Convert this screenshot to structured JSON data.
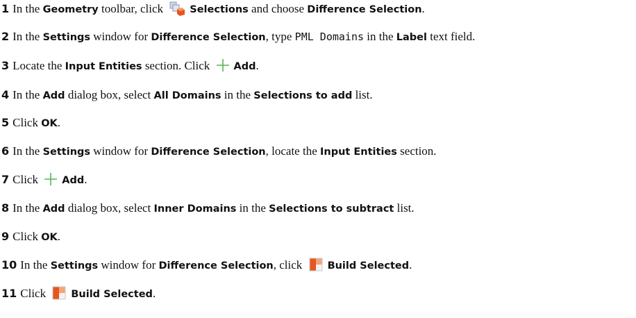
{
  "steps": [
    {
      "number": "1",
      "parts": [
        {
          "t": "t",
          "v": "In the "
        },
        {
          "t": "b",
          "v": "Geometry"
        },
        {
          "t": "t",
          "v": " toolbar, click "
        },
        {
          "t": "icon",
          "icon": "selections-icon"
        },
        {
          "t": "b",
          "v": "Selections"
        },
        {
          "t": "t",
          "v": " and choose "
        },
        {
          "t": "b",
          "v": "Difference Selection"
        },
        {
          "t": "t",
          "v": "."
        }
      ]
    },
    {
      "number": "2",
      "parts": [
        {
          "t": "t",
          "v": "In the "
        },
        {
          "t": "b",
          "v": "Settings"
        },
        {
          "t": "t",
          "v": " window for "
        },
        {
          "t": "b",
          "v": "Difference Selection"
        },
        {
          "t": "t",
          "v": ", type "
        },
        {
          "t": "m",
          "v": "PML Domains"
        },
        {
          "t": "t",
          "v": " in the "
        },
        {
          "t": "b",
          "v": "Label"
        },
        {
          "t": "t",
          "v": " text field."
        }
      ]
    },
    {
      "number": "3",
      "parts": [
        {
          "t": "t",
          "v": "Locate the "
        },
        {
          "t": "b",
          "v": "Input Entities"
        },
        {
          "t": "t",
          "v": " section. Click "
        },
        {
          "t": "icon",
          "icon": "add-plus-icon"
        },
        {
          "t": "b",
          "v": "Add"
        },
        {
          "t": "t",
          "v": "."
        }
      ]
    },
    {
      "number": "4",
      "parts": [
        {
          "t": "t",
          "v": "In the "
        },
        {
          "t": "b",
          "v": "Add"
        },
        {
          "t": "t",
          "v": " dialog box, select "
        },
        {
          "t": "b",
          "v": "All Domains"
        },
        {
          "t": "t",
          "v": " in the "
        },
        {
          "t": "b",
          "v": "Selections to add"
        },
        {
          "t": "t",
          "v": " list."
        }
      ]
    },
    {
      "number": "5",
      "parts": [
        {
          "t": "t",
          "v": "Click "
        },
        {
          "t": "b",
          "v": "OK"
        },
        {
          "t": "t",
          "v": "."
        }
      ]
    },
    {
      "number": "6",
      "parts": [
        {
          "t": "t",
          "v": "In the "
        },
        {
          "t": "b",
          "v": "Settings"
        },
        {
          "t": "t",
          "v": " window for "
        },
        {
          "t": "b",
          "v": "Difference Selection"
        },
        {
          "t": "t",
          "v": ", locate the "
        },
        {
          "t": "b",
          "v": "Input Entities"
        },
        {
          "t": "t",
          "v": " section."
        }
      ]
    },
    {
      "number": "7",
      "parts": [
        {
          "t": "t",
          "v": "Click "
        },
        {
          "t": "icon",
          "icon": "add-plus-icon"
        },
        {
          "t": "b",
          "v": "Add"
        },
        {
          "t": "t",
          "v": "."
        }
      ]
    },
    {
      "number": "8",
      "parts": [
        {
          "t": "t",
          "v": "In the "
        },
        {
          "t": "b",
          "v": "Add"
        },
        {
          "t": "t",
          "v": " dialog box, select "
        },
        {
          "t": "b",
          "v": "Inner Domains"
        },
        {
          "t": "t",
          "v": " in the "
        },
        {
          "t": "b",
          "v": "Selections to subtract"
        },
        {
          "t": "t",
          "v": " list."
        }
      ]
    },
    {
      "number": "9",
      "parts": [
        {
          "t": "t",
          "v": "Click "
        },
        {
          "t": "b",
          "v": "OK"
        },
        {
          "t": "t",
          "v": "."
        }
      ]
    },
    {
      "number": "10",
      "parts": [
        {
          "t": "t",
          "v": "In the "
        },
        {
          "t": "b",
          "v": "Settings"
        },
        {
          "t": "t",
          "v": " window for "
        },
        {
          "t": "b",
          "v": "Difference Selection"
        },
        {
          "t": "t",
          "v": ", click "
        },
        {
          "t": "icon",
          "icon": "build-selected-icon"
        },
        {
          "t": "b",
          "v": "Build Selected"
        },
        {
          "t": "t",
          "v": "."
        }
      ]
    },
    {
      "number": "11",
      "parts": [
        {
          "t": "t",
          "v": "Click "
        },
        {
          "t": "icon",
          "icon": "build-selected-icon"
        },
        {
          "t": "b",
          "v": "Build Selected"
        },
        {
          "t": "t",
          "v": "."
        }
      ]
    }
  ]
}
